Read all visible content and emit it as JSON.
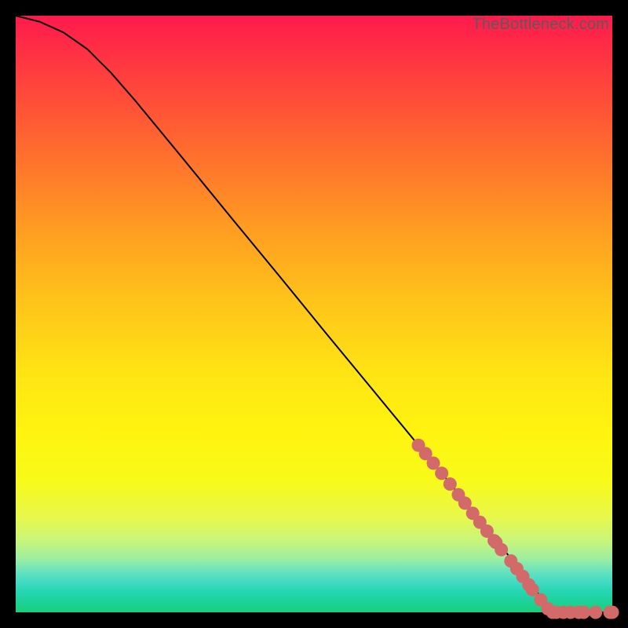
{
  "watermark": "TheBottleneck.com",
  "chart_data": {
    "type": "line",
    "title": "",
    "xlabel": "",
    "ylabel": "",
    "xlim": [
      0,
      100
    ],
    "ylim": [
      0,
      100
    ],
    "curve": {
      "name": "bottleneck-curve",
      "color": "#000000",
      "points": [
        {
          "x": 0,
          "y": 100
        },
        {
          "x": 4,
          "y": 99
        },
        {
          "x": 8,
          "y": 97.2
        },
        {
          "x": 12,
          "y": 94.4
        },
        {
          "x": 16,
          "y": 90.4
        },
        {
          "x": 20,
          "y": 85.8
        },
        {
          "x": 28,
          "y": 76.1
        },
        {
          "x": 36,
          "y": 66.3
        },
        {
          "x": 44,
          "y": 56.6
        },
        {
          "x": 52,
          "y": 46.8
        },
        {
          "x": 60,
          "y": 37.1
        },
        {
          "x": 68,
          "y": 27.4
        },
        {
          "x": 72,
          "y": 22.6
        },
        {
          "x": 76,
          "y": 17.7
        },
        {
          "x": 80,
          "y": 12.8
        },
        {
          "x": 82,
          "y": 10.3
        },
        {
          "x": 84,
          "y": 7.7
        },
        {
          "x": 86,
          "y": 5.1
        },
        {
          "x": 88,
          "y": 2.6
        },
        {
          "x": 90,
          "y": 0.0
        },
        {
          "x": 100,
          "y": 0.0
        }
      ]
    },
    "scatter": {
      "name": "data-points",
      "color": "#D26A6A",
      "radius": 8.5,
      "points": [
        {
          "x": 67.5,
          "y": 28.0
        },
        {
          "x": 68.7,
          "y": 26.6
        },
        {
          "x": 70.0,
          "y": 25.0
        },
        {
          "x": 71.4,
          "y": 23.3
        },
        {
          "x": 72.8,
          "y": 21.5
        },
        {
          "x": 74.2,
          "y": 19.7
        },
        {
          "x": 75.3,
          "y": 18.3
        },
        {
          "x": 76.6,
          "y": 16.6
        },
        {
          "x": 77.8,
          "y": 15.1
        },
        {
          "x": 79.0,
          "y": 13.6
        },
        {
          "x": 80.2,
          "y": 12.0
        },
        {
          "x": 80.5,
          "y": 11.7
        },
        {
          "x": 81.4,
          "y": 10.5
        },
        {
          "x": 83.0,
          "y": 8.6
        },
        {
          "x": 84.0,
          "y": 7.3
        },
        {
          "x": 85.0,
          "y": 6.0
        },
        {
          "x": 86.0,
          "y": 4.6
        },
        {
          "x": 86.6,
          "y": 3.8
        },
        {
          "x": 88.0,
          "y": 2.1
        },
        {
          "x": 89.2,
          "y": 0.6
        },
        {
          "x": 90.0,
          "y": 0.0
        },
        {
          "x": 90.6,
          "y": 0.0
        },
        {
          "x": 91.8,
          "y": 0.0
        },
        {
          "x": 93.0,
          "y": 0.0
        },
        {
          "x": 94.4,
          "y": 0.0
        },
        {
          "x": 95.2,
          "y": 0.0
        },
        {
          "x": 97.2,
          "y": 0.0
        },
        {
          "x": 99.6,
          "y": 0.0
        },
        {
          "x": 100.0,
          "y": 0.0
        }
      ]
    }
  }
}
